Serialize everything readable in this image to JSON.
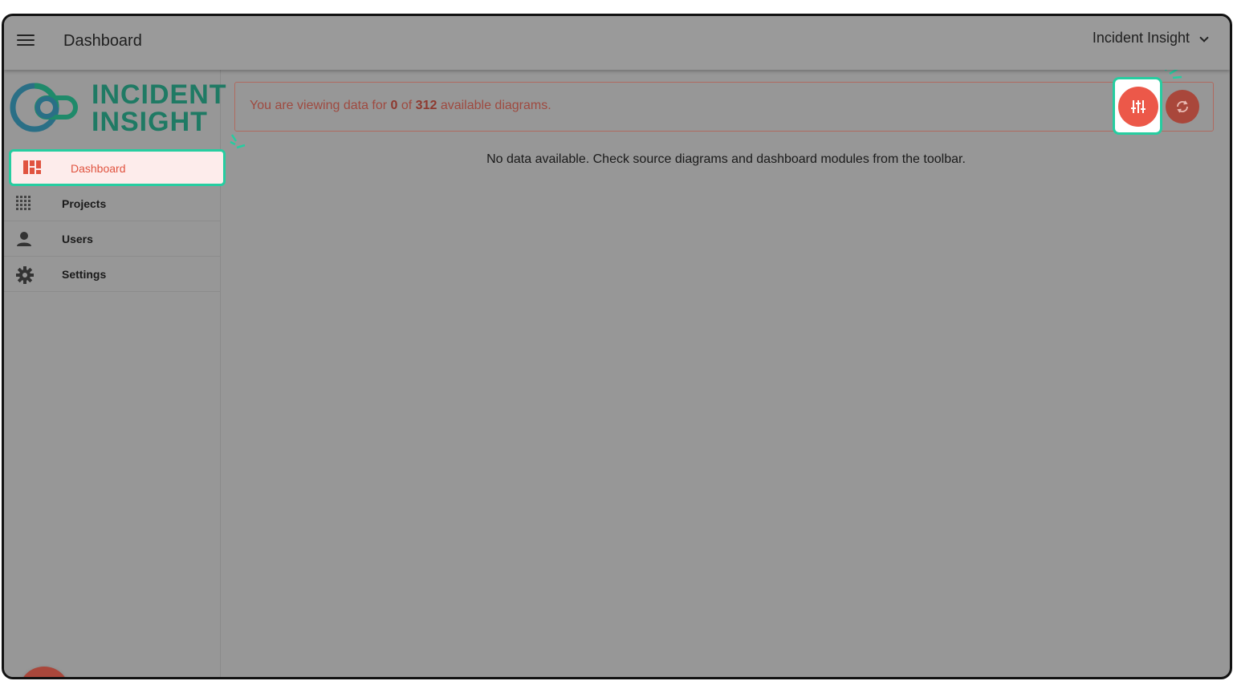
{
  "header": {
    "menu_icon": "hamburger-menu-icon",
    "title": "Dashboard",
    "workspace_name": "Incident Insight"
  },
  "logo": {
    "line1": "INCIDENT",
    "line2": "INSIGHT",
    "color": "#1f7a64"
  },
  "sidebar": {
    "items": [
      {
        "label": "Dashboard",
        "icon": "dashboard-icon",
        "active": true
      },
      {
        "label": "Projects",
        "icon": "grid-icon"
      },
      {
        "label": "Users",
        "icon": "person-icon"
      },
      {
        "label": "Settings",
        "icon": "gear-icon"
      }
    ]
  },
  "banner": {
    "prefix": "You are viewing data for ",
    "viewing_count": "0",
    "middle": " of ",
    "total_count": "312",
    "suffix": " available diagrams."
  },
  "main": {
    "empty_message": "No data available. Check source diagrams and dashboard modules from the toolbar."
  },
  "colors": {
    "accent": "#ec5849",
    "highlight": "#26cda0",
    "active_bg": "#fdeceb"
  }
}
